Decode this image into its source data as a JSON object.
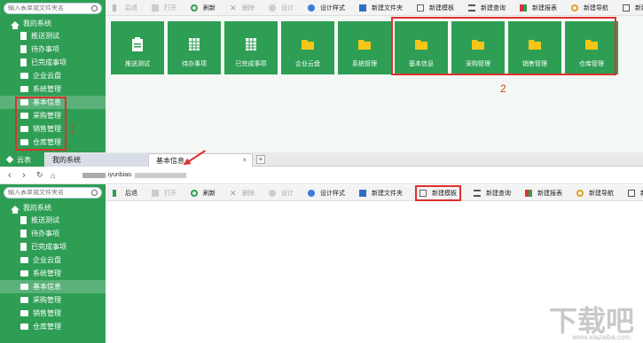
{
  "sidebar": {
    "search_placeholder": "输入表单或文件夹名",
    "root": "我的系统",
    "items": [
      {
        "label": "推送测试",
        "type": "doc"
      },
      {
        "label": "待办事项",
        "type": "doc"
      },
      {
        "label": "已完成事项",
        "type": "doc"
      },
      {
        "label": "企业云盘",
        "type": "folder"
      },
      {
        "label": "系统管理",
        "type": "folder"
      },
      {
        "label": "基本信息",
        "type": "folder"
      },
      {
        "label": "采购管理",
        "type": "folder"
      },
      {
        "label": "销售管理",
        "type": "folder"
      },
      {
        "label": "仓库管理",
        "type": "folder"
      }
    ]
  },
  "toolbar": {
    "back": "后退",
    "open": "打开",
    "refresh": "刷新",
    "delete": "删除",
    "design": "设计",
    "style": "设计样式",
    "new_folder": "新建文件夹",
    "new_template": "新建模板",
    "new_query": "新建查询",
    "new_report": "新建报表",
    "new_nav": "新建导航",
    "new_flow": "新建流程"
  },
  "tiles": [
    "推送测试",
    "待办事项",
    "已完成事项",
    "企业云盘",
    "系统管理",
    "基本信息",
    "采购管理",
    "销售管理",
    "仓库管理"
  ],
  "annotations": {
    "num1": "1",
    "num2": "2"
  },
  "tabs": {
    "cloud": "云表",
    "tab1": "我的系统",
    "tab2": "基本信息",
    "close": "×",
    "new": "+"
  },
  "address": {
    "url_visible": ".iyunbiao."
  },
  "watermark": {
    "big": "下载吧",
    "small": "www.xiazaiba.com"
  },
  "colors": {
    "green": "#2e9e55",
    "accent_red": "#e03030"
  }
}
